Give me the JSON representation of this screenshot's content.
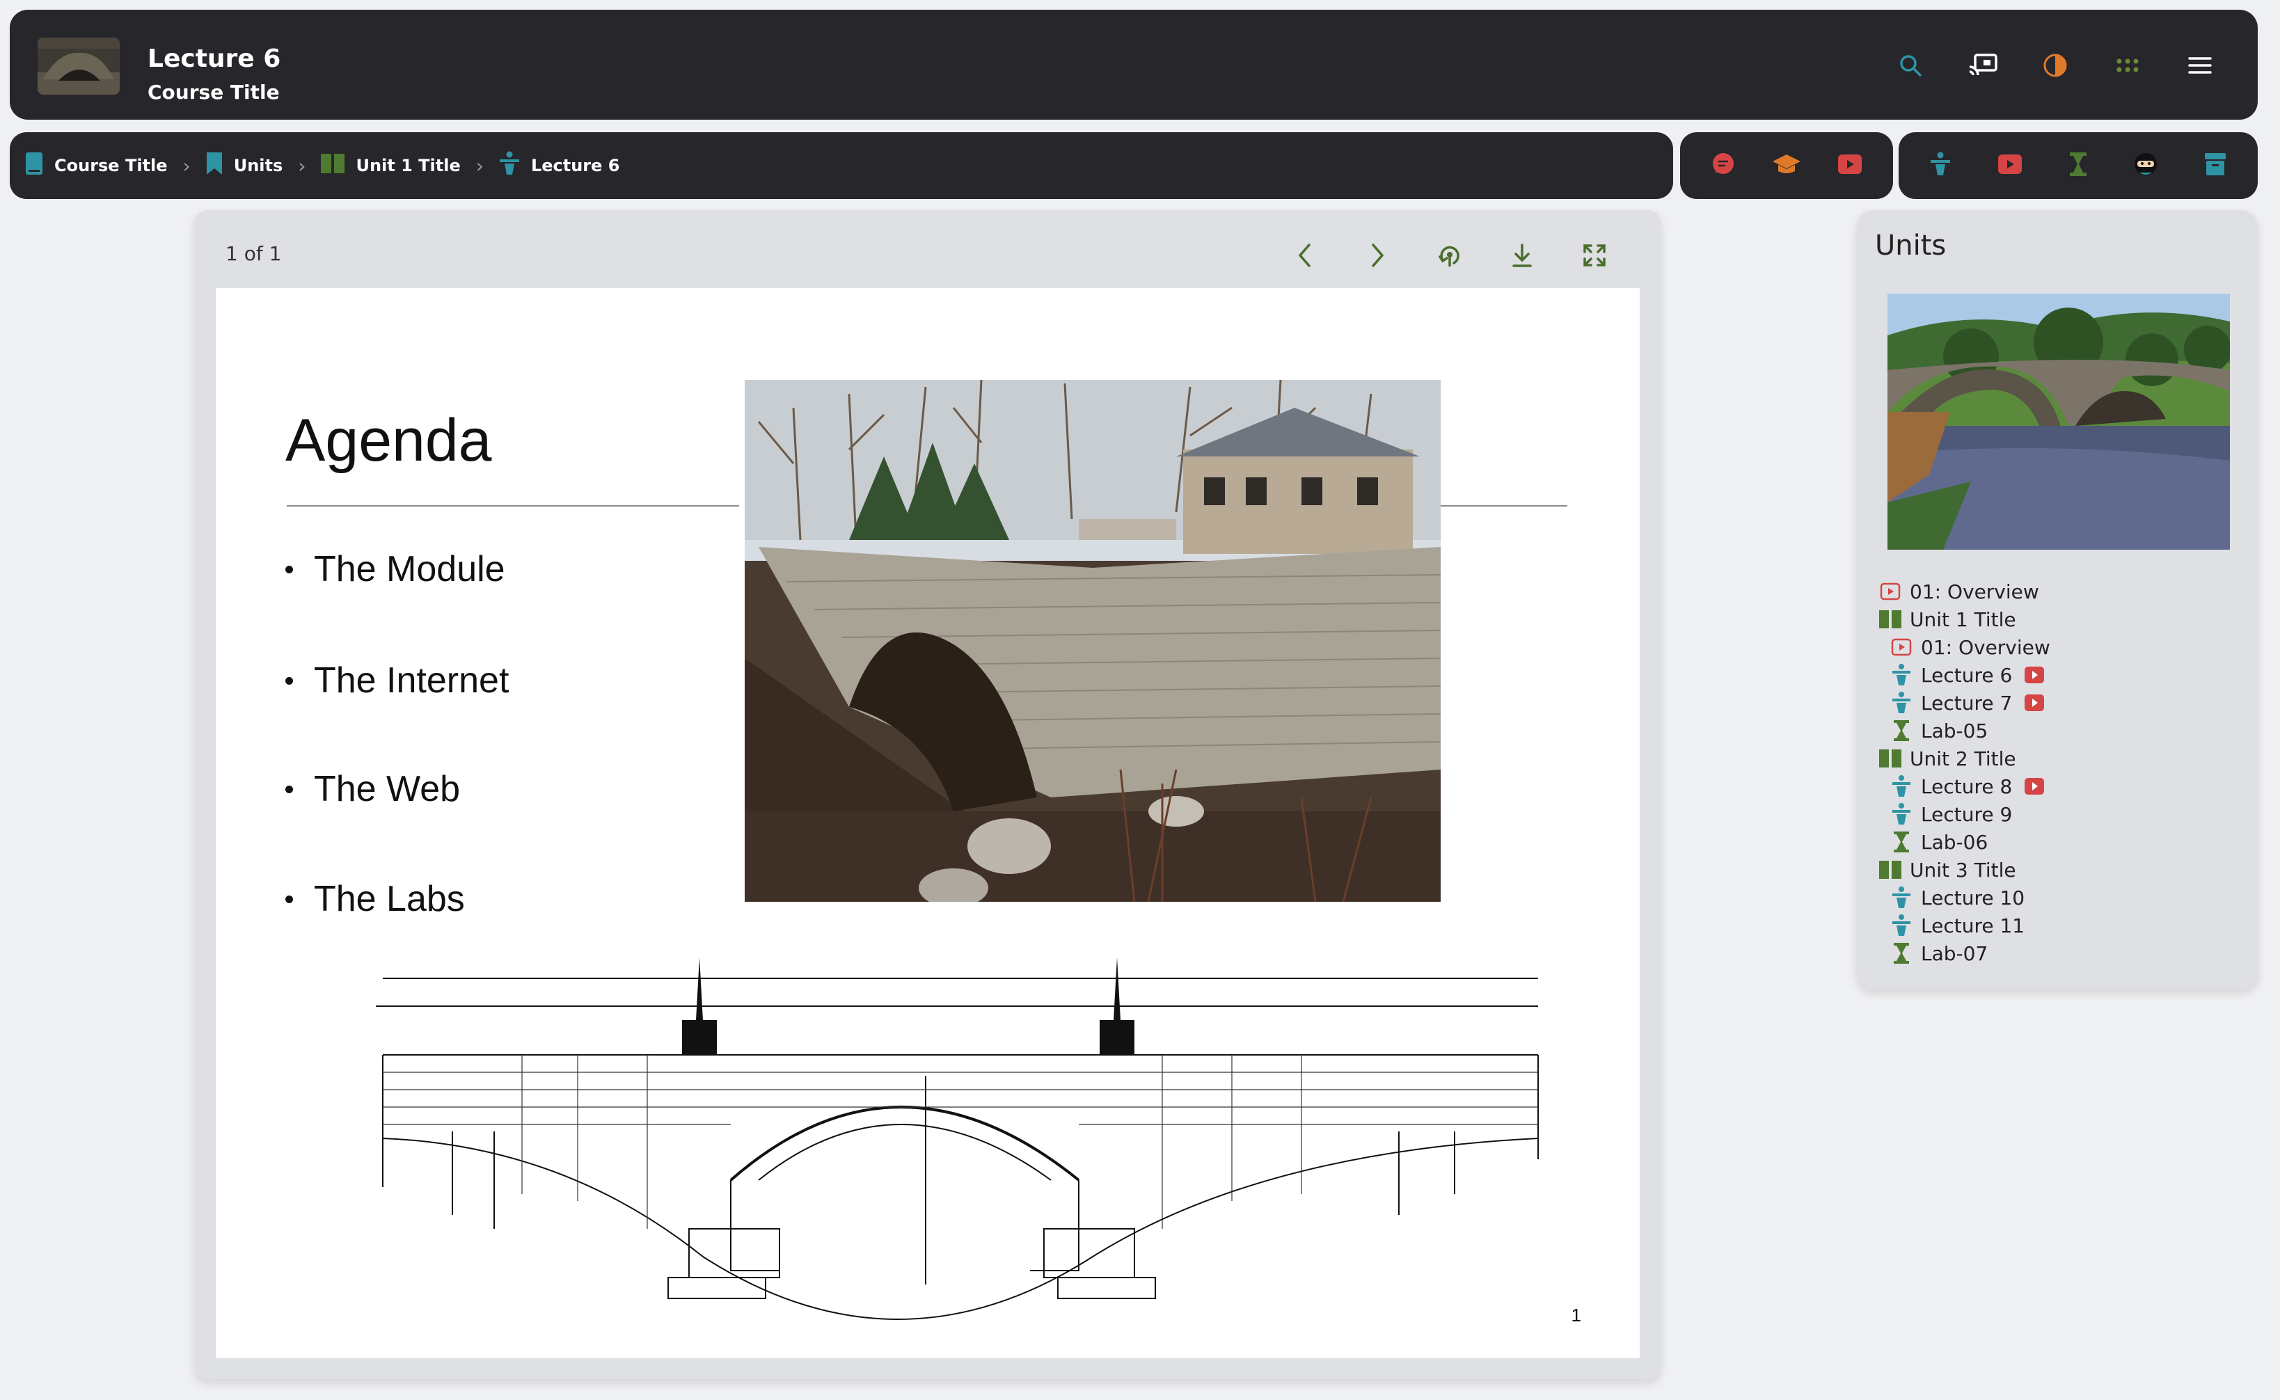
{
  "header": {
    "title": "Lecture 6",
    "subtitle": "Course Title",
    "icons": [
      "search-icon",
      "cast-icon",
      "contrast-icon",
      "apps-icon",
      "menu-icon"
    ]
  },
  "breadcrumb": [
    {
      "label": "Course Title",
      "icon": "book-icon"
    },
    {
      "label": "Units",
      "icon": "bookmark-icon"
    },
    {
      "label": "Unit 1 Title",
      "icon": "open-book-icon"
    },
    {
      "label": "Lecture 6",
      "icon": "lecture-icon"
    }
  ],
  "viewer": {
    "page_indicator": "1 of 1",
    "controls": [
      "prev-icon",
      "next-icon",
      "rotate-icon",
      "download-icon",
      "fullscreen-icon"
    ],
    "slide": {
      "title": "Agenda",
      "bullets": [
        "The Module",
        "The Internet",
        "The Web",
        "The Labs"
      ],
      "page_number": "1"
    }
  },
  "units_panel": {
    "title": "Units",
    "items": [
      {
        "label": "01: Overview",
        "level": 0,
        "icon": "video-icon"
      },
      {
        "label": "Unit 1 Title",
        "level": 0,
        "icon": "open-book-icon"
      },
      {
        "label": "01: Overview",
        "level": 1,
        "icon": "video-icon"
      },
      {
        "label": "Lecture 6",
        "level": 1,
        "icon": "lecture-icon",
        "video": true
      },
      {
        "label": "Lecture 7",
        "level": 1,
        "icon": "lecture-icon",
        "video": true
      },
      {
        "label": "Lab-05",
        "level": 1,
        "icon": "lab-icon"
      },
      {
        "label": "Unit 2 Title",
        "level": 0,
        "icon": "open-book-icon"
      },
      {
        "label": "Lecture 8",
        "level": 1,
        "icon": "lecture-icon",
        "video": true
      },
      {
        "label": "Lecture 9",
        "level": 1,
        "icon": "lecture-icon"
      },
      {
        "label": "Lab-06",
        "level": 1,
        "icon": "lab-icon"
      },
      {
        "label": "Unit 3 Title",
        "level": 0,
        "icon": "open-book-icon"
      },
      {
        "label": "Lecture 10",
        "level": 1,
        "icon": "lecture-icon"
      },
      {
        "label": "Lecture 11",
        "level": 1,
        "icon": "lecture-icon"
      },
      {
        "label": "Lab-07",
        "level": 1,
        "icon": "lab-icon"
      }
    ]
  },
  "colors": {
    "bar_bg": "#27262b",
    "teal": "#2e94a5",
    "red": "#d64545",
    "orange": "#e07a2a",
    "green": "#4f7a32"
  }
}
